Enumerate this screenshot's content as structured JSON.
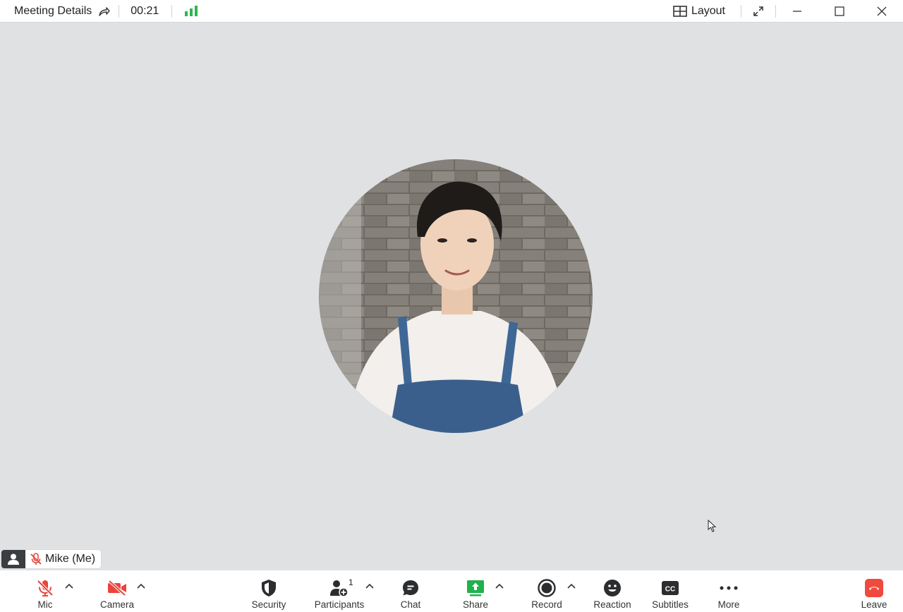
{
  "titlebar": {
    "meeting_details": "Meeting Details",
    "timer": "00:21",
    "layout_label": "Layout"
  },
  "participant": {
    "name": "Mike (Me)"
  },
  "toolbar": {
    "mic": "Mic",
    "camera": "Camera",
    "security": "Security",
    "participants": "Participants",
    "participants_count": "1",
    "chat": "Chat",
    "share": "Share",
    "record": "Record",
    "reaction": "Reaction",
    "subtitles": "Subtitles",
    "more": "More",
    "leave": "Leave"
  },
  "colors": {
    "muted_red": "#e8453c",
    "share_green": "#22b14c",
    "signal_green": "#2db84d",
    "leave_red": "#f04a3e",
    "stage_bg": "#dfe1e3"
  },
  "icons": {
    "share_out": "share-out-icon",
    "signal": "signal-bars-icon",
    "layout": "grid-icon",
    "fullscreen": "expand-icon",
    "minimize": "minimize-icon",
    "maximize": "maximize-icon",
    "close": "close-icon"
  }
}
